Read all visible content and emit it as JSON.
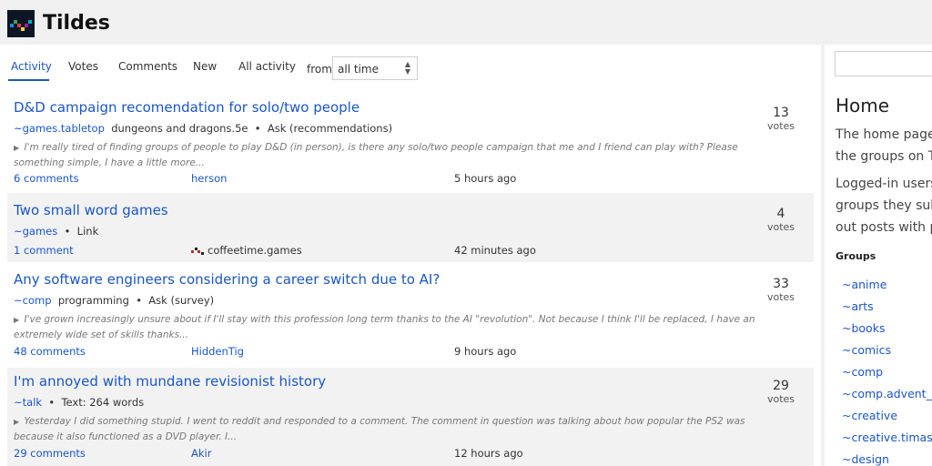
{
  "site": {
    "name": "Tildes"
  },
  "tabs": [
    {
      "label": "Activity",
      "active": true
    },
    {
      "label": "Votes",
      "active": false
    },
    {
      "label": "Comments",
      "active": false
    },
    {
      "label": "New",
      "active": false
    },
    {
      "label": "All activity",
      "active": false
    }
  ],
  "period": {
    "from_label": "from",
    "selected": "all time"
  },
  "topics": [
    {
      "title": "D&D campaign recomendation for solo/two people",
      "group": "~games.tabletop",
      "tags": "dungeons and dragons.5e",
      "type": "Ask (recommendations)",
      "excerpt": "I'm really tired of finding groups of people to play D&D (in person), is there any solo/two people campaign that me and I friend can play with? Please something simple, I have a little more...",
      "comments": "6 comments",
      "author": "herson",
      "time": "5 hours ago",
      "votes": "13",
      "votes_label": "votes"
    },
    {
      "title": "Two small word games",
      "group": "~games",
      "tags": "",
      "type": "Link",
      "excerpt": "",
      "comments": "1 comment",
      "author": "coffeetime.games",
      "time": "42 minutes ago",
      "votes": "4",
      "votes_label": "votes"
    },
    {
      "title": "Any software engineers considering a career switch due to AI?",
      "group": "~comp",
      "tags": "programming",
      "type": "Ask (survey)",
      "excerpt": "I've grown increasingly unsure about if I'll stay with this profession long term thanks to the AI \"revolution\". Not because I think I'll be replaced, I have an extremely wide set of skills thanks...",
      "comments": "48 comments",
      "author": "HiddenTig",
      "time": "9 hours ago",
      "votes": "33",
      "votes_label": "votes"
    },
    {
      "title": "I'm annoyed with mundane revisionist history",
      "group": "~talk",
      "tags": "",
      "type": "Text: 264 words",
      "excerpt": "Yesterday I did something stupid. I went to reddit and responded to a comment. The comment in question was talking about how popular the PS2 was because it also functioned as a DVD player. I...",
      "comments": "29 comments",
      "author": "Akir",
      "time": "12 hours ago",
      "votes": "29",
      "votes_label": "votes"
    }
  ],
  "sidebar": {
    "heading": "Home",
    "para1": [
      "The home page",
      "the groups on T"
    ],
    "para2": [
      "Logged-in users",
      "groups they sub",
      "out posts with p"
    ],
    "groups_heading": "Groups",
    "groups": [
      "~anime",
      "~arts",
      "~books",
      "~comics",
      "~comp",
      "~comp.advent_o",
      "~creative",
      "~creative.timaso",
      "~design"
    ]
  },
  "colors": {
    "link": "#1a56c7",
    "alt_row": "#f2f2f2",
    "page_bg": "#f0f0f0"
  }
}
